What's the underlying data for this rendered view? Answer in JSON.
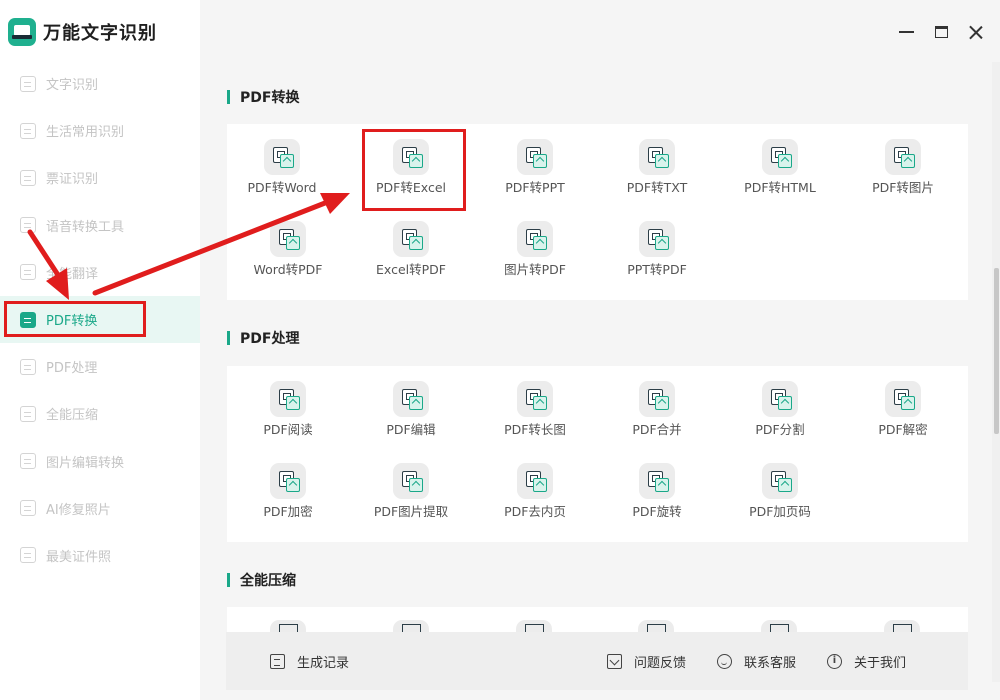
{
  "app": {
    "title": "万能文字识别"
  },
  "window_controls": {
    "minimize": "minimize",
    "maximize": "maximize",
    "close": "close"
  },
  "sidebar": {
    "items": [
      {
        "label": "文字识别",
        "active": false
      },
      {
        "label": "生活常用识别",
        "active": false
      },
      {
        "label": "票证识别",
        "active": false
      },
      {
        "label": "语音转换工具",
        "active": false
      },
      {
        "label": "全能翻译",
        "active": false
      },
      {
        "label": "PDF转换",
        "active": true
      },
      {
        "label": "PDF处理",
        "active": false
      },
      {
        "label": "全能压缩",
        "active": false
      },
      {
        "label": "图片编辑转换",
        "active": false
      },
      {
        "label": "AI修复照片",
        "active": false
      },
      {
        "label": "最美证件照",
        "active": false
      }
    ]
  },
  "sections": [
    {
      "title": "PDF转换",
      "tools": [
        "PDF转Word",
        "PDF转Excel",
        "PDF转PPT",
        "PDF转TXT",
        "PDF转HTML",
        "PDF转图片",
        "Word转PDF",
        "Excel转PDF",
        "图片转PDF",
        "PPT转PDF"
      ]
    },
    {
      "title": "PDF处理",
      "tools": [
        "PDF阅读",
        "PDF编辑",
        "PDF转长图",
        "PDF合并",
        "PDF分割",
        "PDF解密",
        "PDF加密",
        "PDF图片提取",
        "PDF去内页",
        "PDF旋转",
        "PDF加页码"
      ]
    },
    {
      "title": "全能压缩",
      "tools": []
    }
  ],
  "footer": {
    "records": "生成记录",
    "feedback": "问题反馈",
    "service": "联系客服",
    "about": "关于我们"
  },
  "colors": {
    "accent": "#1aa889",
    "highlight": "#e01d1d"
  }
}
